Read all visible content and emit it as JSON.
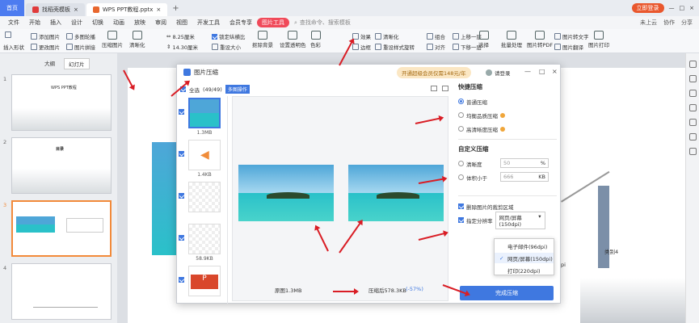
{
  "titlebar": {
    "home": "首页",
    "tabs": [
      "找稻壳模板",
      "WPS PPT教程.pptx"
    ],
    "login": "立即登录"
  },
  "menubar": {
    "items": [
      "文件",
      "开始",
      "插入",
      "设计",
      "切换",
      "动画",
      "放映",
      "审阅",
      "视图",
      "开发工具",
      "会员专享",
      "图片工具"
    ],
    "search": "查找命令、搜索模板",
    "right": [
      "未上云",
      "协作",
      "分享"
    ]
  },
  "ribbon": {
    "insert_shape": "插入形状",
    "change_img": "更改图片",
    "add_img": "添加图片",
    "multi_img": "多图轮播",
    "img_stitch": "图片拼接",
    "compress": "压缩图片",
    "sharpen": "清晰化",
    "width": "8.25厘米",
    "height": "14.30厘米",
    "lock_ratio": "锁定纵横比",
    "reset_size": "重设大小",
    "crop": "裁剪",
    "remove_bg": "抠除背景",
    "set_transparent": "设置透明色",
    "color": "色彩",
    "border": "边框",
    "reset_style": "重设样式",
    "effect": "效果",
    "rotate": "旋转",
    "align": "对齐",
    "combine": "组合",
    "up": "上移一层",
    "down": "下移一层",
    "select": "选择",
    "batch": "批量处理",
    "to_pdf": "图片转PDF",
    "to_text": "图片转文字",
    "translate": "图片翻译",
    "print": "图片打印"
  },
  "leftpanel": {
    "tabs": [
      "大纲",
      "幻灯片"
    ],
    "thumbs": [
      "1",
      "2",
      "3",
      "4"
    ],
    "thumb_titles": [
      "WPS PPT教程",
      "目录",
      "",
      ""
    ]
  },
  "dialog": {
    "title": "图片压缩",
    "vip": "开通超级会员仅需148元/年",
    "login": "请登录",
    "select_all": "全选",
    "count": "(49/49)",
    "multi": "多图操作",
    "files": [
      "1.3MB",
      "1.4KB",
      "",
      "58.9KB",
      ""
    ],
    "original": "原图1.3MB",
    "compressed": "压缩后578.3KB",
    "ratio": "(-57%)",
    "quick_title": "快捷压缩",
    "opts": [
      "普通压缩",
      "均衡品质压缩",
      "高清晰度压缩"
    ],
    "custom_title": "自定义压缩",
    "clarity": "清晰度",
    "clarity_val": "50",
    "clarity_unit": "%",
    "size_limit": "体积小于",
    "size_val": "666",
    "size_unit": "KB",
    "delete_crop": "删除图片的裁剪区域",
    "target_res": "指定分辨率",
    "res_selected": "网页/屏幕(150dpi)",
    "res_options": [
      "电子邮件(96dpi)",
      "网页/屏幕(150dpi)",
      "打印(220dpi)"
    ],
    "finish": "完成压缩"
  },
  "slide": {
    "series_label": "类别4",
    "axis_label": "pi"
  },
  "colors": {
    "accent": "#3f78e0",
    "menu_hl": "#f04a5a",
    "arrow": "#d91d25",
    "home": "#4d7cf0"
  }
}
